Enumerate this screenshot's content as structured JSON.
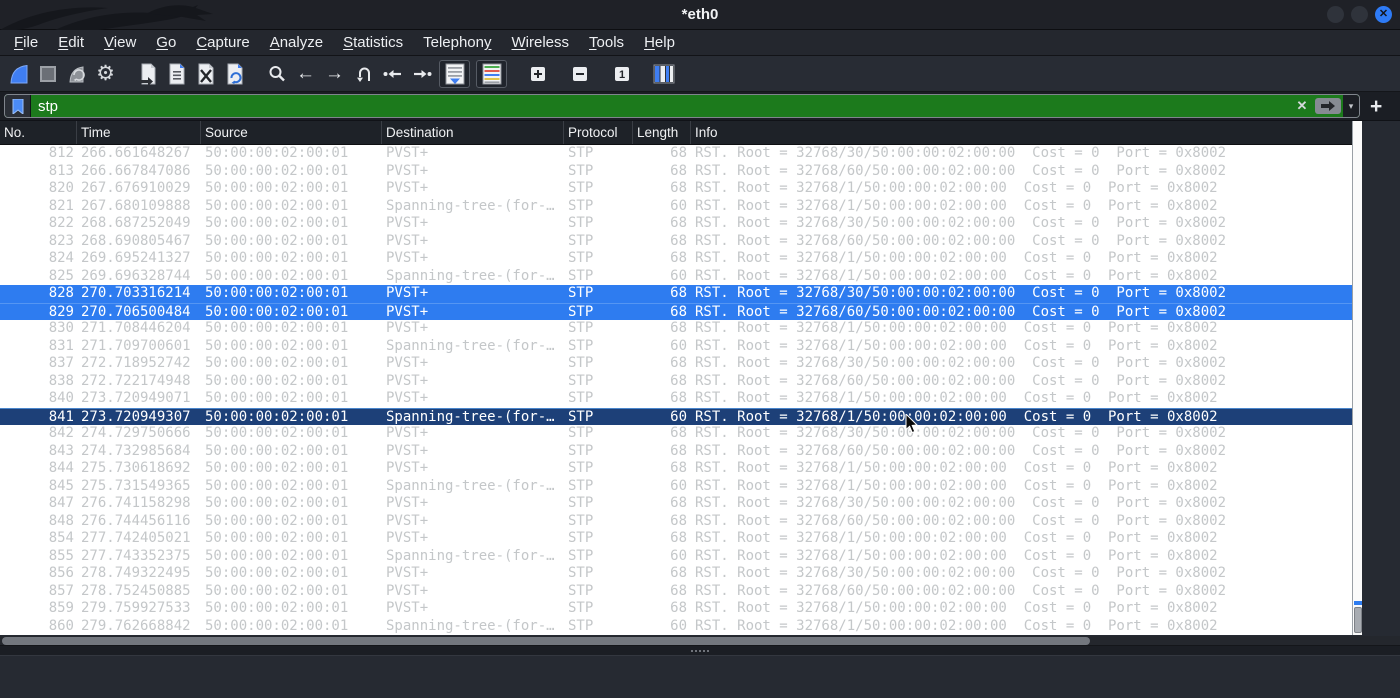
{
  "window": {
    "title": "*eth0",
    "controls": {
      "minimize": "",
      "maximize": "",
      "close_glyph": "✕"
    }
  },
  "menu": {
    "items": [
      {
        "label": "File",
        "accel_index": 0
      },
      {
        "label": "Edit",
        "accel_index": 0
      },
      {
        "label": "View",
        "accel_index": 0
      },
      {
        "label": "Go",
        "accel_index": 0
      },
      {
        "label": "Capture",
        "accel_index": 0
      },
      {
        "label": "Analyze",
        "accel_index": 0
      },
      {
        "label": "Statistics",
        "accel_index": 0
      },
      {
        "label": "Telephony",
        "accel_index": 8
      },
      {
        "label": "Wireless",
        "accel_index": 0
      },
      {
        "label": "Tools",
        "accel_index": 0
      },
      {
        "label": "Help",
        "accel_index": 0
      }
    ]
  },
  "toolbar": {
    "icons": [
      "start-capture",
      "stop-capture",
      "restart-capture",
      "capture-options",
      "open-file",
      "save-file",
      "close-file",
      "reload-file",
      "find-packet",
      "go-back",
      "go-forward",
      "go-to-packet",
      "go-first-packet",
      "go-last-packet",
      "auto-scroll-toggle",
      "colorize-toggle",
      "zoom-in",
      "zoom-out",
      "normal-size",
      "resize-columns"
    ],
    "accent_blue": "#3f7ef2"
  },
  "filter": {
    "value": "stp",
    "valid_background": "#1c7a1c",
    "clear_glyph": "✕",
    "caret_glyph": "▾",
    "add_glyph": "+"
  },
  "packet_list": {
    "columns": [
      "No.",
      "Time",
      "Source",
      "Destination",
      "Protocol",
      "Length",
      "Info"
    ],
    "rows": [
      {
        "no": "812",
        "time": "266.661648267",
        "source": "50:00:00:02:00:01",
        "destination": "PVST+",
        "protocol": "STP",
        "length": "68",
        "info": "RST. Root = 32768/30/50:00:00:02:00:00  Cost = 0  Port = 0x8002",
        "state": ""
      },
      {
        "no": "813",
        "time": "266.667847086",
        "source": "50:00:00:02:00:01",
        "destination": "PVST+",
        "protocol": "STP",
        "length": "68",
        "info": "RST. Root = 32768/60/50:00:00:02:00:00  Cost = 0  Port = 0x8002",
        "state": ""
      },
      {
        "no": "820",
        "time": "267.676910029",
        "source": "50:00:00:02:00:01",
        "destination": "PVST+",
        "protocol": "STP",
        "length": "68",
        "info": "RST. Root = 32768/1/50:00:00:02:00:00  Cost = 0  Port = 0x8002",
        "state": ""
      },
      {
        "no": "821",
        "time": "267.680109888",
        "source": "50:00:00:02:00:01",
        "destination": "Spanning-tree-(for-…",
        "protocol": "STP",
        "length": "60",
        "info": "RST. Root = 32768/1/50:00:00:02:00:00  Cost = 0  Port = 0x8002",
        "state": ""
      },
      {
        "no": "822",
        "time": "268.687252049",
        "source": "50:00:00:02:00:01",
        "destination": "PVST+",
        "protocol": "STP",
        "length": "68",
        "info": "RST. Root = 32768/30/50:00:00:02:00:00  Cost = 0  Port = 0x8002",
        "state": ""
      },
      {
        "no": "823",
        "time": "268.690805467",
        "source": "50:00:00:02:00:01",
        "destination": "PVST+",
        "protocol": "STP",
        "length": "68",
        "info": "RST. Root = 32768/60/50:00:00:02:00:00  Cost = 0  Port = 0x8002",
        "state": ""
      },
      {
        "no": "824",
        "time": "269.695241327",
        "source": "50:00:00:02:00:01",
        "destination": "PVST+",
        "protocol": "STP",
        "length": "68",
        "info": "RST. Root = 32768/1/50:00:00:02:00:00  Cost = 0  Port = 0x8002",
        "state": ""
      },
      {
        "no": "825",
        "time": "269.696328744",
        "source": "50:00:00:02:00:01",
        "destination": "Spanning-tree-(for-…",
        "protocol": "STP",
        "length": "60",
        "info": "RST. Root = 32768/1/50:00:00:02:00:00  Cost = 0  Port = 0x8002",
        "state": ""
      },
      {
        "no": "828",
        "time": "270.703316214",
        "source": "50:00:00:02:00:01",
        "destination": "PVST+",
        "protocol": "STP",
        "length": "68",
        "info": "RST. Root = 32768/30/50:00:00:02:00:00  Cost = 0  Port = 0x8002",
        "state": "selected"
      },
      {
        "no": "829",
        "time": "270.706500484",
        "source": "50:00:00:02:00:01",
        "destination": "PVST+",
        "protocol": "STP",
        "length": "68",
        "info": "RST. Root = 32768/60/50:00:00:02:00:00  Cost = 0  Port = 0x8002",
        "state": "selected"
      },
      {
        "no": "830",
        "time": "271.708446204",
        "source": "50:00:00:02:00:01",
        "destination": "PVST+",
        "protocol": "STP",
        "length": "68",
        "info": "RST. Root = 32768/1/50:00:00:02:00:00  Cost = 0  Port = 0x8002",
        "state": ""
      },
      {
        "no": "831",
        "time": "271.709700601",
        "source": "50:00:00:02:00:01",
        "destination": "Spanning-tree-(for-…",
        "protocol": "STP",
        "length": "60",
        "info": "RST. Root = 32768/1/50:00:00:02:00:00  Cost = 0  Port = 0x8002",
        "state": ""
      },
      {
        "no": "837",
        "time": "272.718952742",
        "source": "50:00:00:02:00:01",
        "destination": "PVST+",
        "protocol": "STP",
        "length": "68",
        "info": "RST. Root = 32768/30/50:00:00:02:00:00  Cost = 0  Port = 0x8002",
        "state": ""
      },
      {
        "no": "838",
        "time": "272.722174948",
        "source": "50:00:00:02:00:01",
        "destination": "PVST+",
        "protocol": "STP",
        "length": "68",
        "info": "RST. Root = 32768/60/50:00:00:02:00:00  Cost = 0  Port = 0x8002",
        "state": ""
      },
      {
        "no": "840",
        "time": "273.720949071",
        "source": "50:00:00:02:00:01",
        "destination": "PVST+",
        "protocol": "STP",
        "length": "68",
        "info": "RST. Root = 32768/1/50:00:00:02:00:00  Cost = 0  Port = 0x8002",
        "state": ""
      },
      {
        "no": "841",
        "time": "273.720949307",
        "source": "50:00:00:02:00:01",
        "destination": "Spanning-tree-(for-…",
        "protocol": "STP",
        "length": "60",
        "info": "RST. Root = 32768/1/50:00:00:02:00:00  Cost = 0  Port = 0x8002",
        "state": "focused"
      },
      {
        "no": "842",
        "time": "274.729750666",
        "source": "50:00:00:02:00:01",
        "destination": "PVST+",
        "protocol": "STP",
        "length": "68",
        "info": "RST. Root = 32768/30/50:00:00:02:00:00  Cost = 0  Port = 0x8002",
        "state": ""
      },
      {
        "no": "843",
        "time": "274.732985684",
        "source": "50:00:00:02:00:01",
        "destination": "PVST+",
        "protocol": "STP",
        "length": "68",
        "info": "RST. Root = 32768/60/50:00:00:02:00:00  Cost = 0  Port = 0x8002",
        "state": ""
      },
      {
        "no": "844",
        "time": "275.730618692",
        "source": "50:00:00:02:00:01",
        "destination": "PVST+",
        "protocol": "STP",
        "length": "68",
        "info": "RST. Root = 32768/1/50:00:00:02:00:00  Cost = 0  Port = 0x8002",
        "state": ""
      },
      {
        "no": "845",
        "time": "275.731549365",
        "source": "50:00:00:02:00:01",
        "destination": "Spanning-tree-(for-…",
        "protocol": "STP",
        "length": "60",
        "info": "RST. Root = 32768/1/50:00:00:02:00:00  Cost = 0  Port = 0x8002",
        "state": ""
      },
      {
        "no": "847",
        "time": "276.741158298",
        "source": "50:00:00:02:00:01",
        "destination": "PVST+",
        "protocol": "STP",
        "length": "68",
        "info": "RST. Root = 32768/30/50:00:00:02:00:00  Cost = 0  Port = 0x8002",
        "state": ""
      },
      {
        "no": "848",
        "time": "276.744456116",
        "source": "50:00:00:02:00:01",
        "destination": "PVST+",
        "protocol": "STP",
        "length": "68",
        "info": "RST. Root = 32768/60/50:00:00:02:00:00  Cost = 0  Port = 0x8002",
        "state": ""
      },
      {
        "no": "854",
        "time": "277.742405021",
        "source": "50:00:00:02:00:01",
        "destination": "PVST+",
        "protocol": "STP",
        "length": "68",
        "info": "RST. Root = 32768/1/50:00:00:02:00:00  Cost = 0  Port = 0x8002",
        "state": ""
      },
      {
        "no": "855",
        "time": "277.743352375",
        "source": "50:00:00:02:00:01",
        "destination": "Spanning-tree-(for-…",
        "protocol": "STP",
        "length": "60",
        "info": "RST. Root = 32768/1/50:00:00:02:00:00  Cost = 0  Port = 0x8002",
        "state": ""
      },
      {
        "no": "856",
        "time": "278.749322495",
        "source": "50:00:00:02:00:01",
        "destination": "PVST+",
        "protocol": "STP",
        "length": "68",
        "info": "RST. Root = 32768/30/50:00:00:02:00:00  Cost = 0  Port = 0x8002",
        "state": ""
      },
      {
        "no": "857",
        "time": "278.752450885",
        "source": "50:00:00:02:00:01",
        "destination": "PVST+",
        "protocol": "STP",
        "length": "68",
        "info": "RST. Root = 32768/60/50:00:00:02:00:00  Cost = 0  Port = 0x8002",
        "state": ""
      },
      {
        "no": "859",
        "time": "279.759927533",
        "source": "50:00:00:02:00:01",
        "destination": "PVST+",
        "protocol": "STP",
        "length": "68",
        "info": "RST. Root = 32768/1/50:00:00:02:00:00  Cost = 0  Port = 0x8002",
        "state": ""
      },
      {
        "no": "860",
        "time": "279.762668842",
        "source": "50:00:00:02:00:01",
        "destination": "Spanning-tree-(for-…",
        "protocol": "STP",
        "length": "60",
        "info": "RST. Root = 32768/1/50:00:00:02:00:00  Cost = 0  Port = 0x8002",
        "state": ""
      }
    ],
    "selection_color": "#2e7cf0",
    "focused_color": "#1d4078"
  }
}
